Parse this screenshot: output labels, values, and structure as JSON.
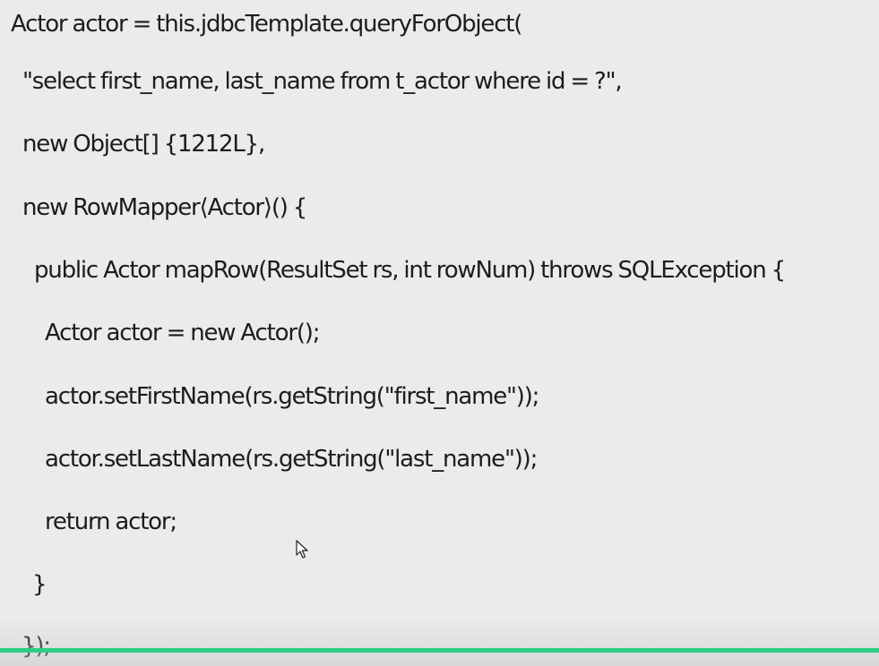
{
  "code": {
    "lines": [
      "Actor actor = this.jdbcTemplate.queryForObject(",
      "\"select first_name, last_name from t_actor where id = ?\",",
      "new Object[] {1212L},",
      "new RowMapper⟨Actor⟩() {",
      "public Actor mapRow(ResultSet rs, int rowNum) throws SQLException {",
      "Actor actor = new Actor();",
      "actor.setFirstName(rs.getString(\"first_name\"));",
      "actor.setLastName(rs.getString(\"last_name\"));",
      "return actor;",
      "}",
      "});"
    ]
  },
  "player": {
    "progress_fraction": 1.0,
    "accent_color": "#2ecf84"
  },
  "cursor": {
    "icon": "mouse-pointer-icon"
  }
}
